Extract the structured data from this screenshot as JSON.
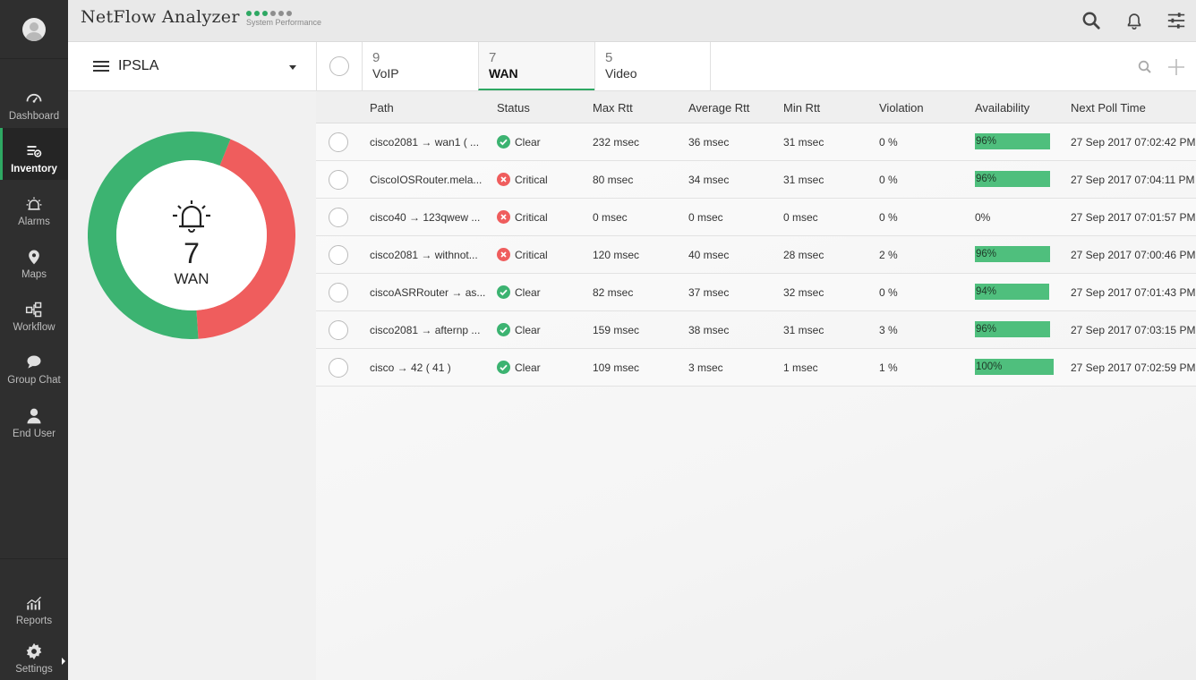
{
  "app": {
    "title": "NetFlow Analyzer",
    "perf_label": "System Performance"
  },
  "sidebar": {
    "items": [
      {
        "label": "Dashboard",
        "icon": "gauge-icon"
      },
      {
        "label": "Inventory",
        "icon": "inventory-icon",
        "active": true
      },
      {
        "label": "Alarms",
        "icon": "alarm-icon"
      },
      {
        "label": "Maps",
        "icon": "map-pin-icon"
      },
      {
        "label": "Workflow",
        "icon": "workflow-icon"
      },
      {
        "label": "Group Chat",
        "icon": "chat-icon"
      },
      {
        "label": "End User",
        "icon": "user-icon"
      }
    ],
    "bottom_items": [
      {
        "label": "Reports",
        "icon": "reports-icon"
      },
      {
        "label": "Settings",
        "icon": "gear-icon"
      }
    ]
  },
  "group_select": {
    "label": "IPSLA"
  },
  "tabs": [
    {
      "count": "9",
      "name": "VoIP"
    },
    {
      "count": "7",
      "name": "WAN",
      "active": true
    },
    {
      "count": "5",
      "name": "Video"
    }
  ],
  "summary": {
    "count": "7",
    "label": "WAN",
    "clear": 4,
    "critical": 3,
    "colors": {
      "clear": "#3cb371",
      "critical": "#ef5d5d"
    }
  },
  "table": {
    "headers": [
      "Path",
      "Status",
      "Max Rtt",
      "Average Rtt",
      "Min Rtt",
      "Violation",
      "Availability",
      "Next Poll Time"
    ],
    "rows": [
      {
        "path": "cisco2081 → wan1 ( ...",
        "status": "Clear",
        "max_rtt": "232 msec",
        "avg_rtt": "36 msec",
        "min_rtt": "31 msec",
        "violation": "0 %",
        "availability": "96%",
        "availability_value": 0.96,
        "next_poll": "27 Sep 2017 07:02:42 PM"
      },
      {
        "path": "CiscoIOSRouter.mela...",
        "status": "Critical",
        "max_rtt": "80 msec",
        "avg_rtt": "34 msec",
        "min_rtt": "31 msec",
        "violation": "0 %",
        "availability": "96%",
        "availability_value": 0.96,
        "next_poll": "27 Sep 2017 07:04:11 PM"
      },
      {
        "path": "cisco40 → 123qwew ...",
        "status": "Critical",
        "max_rtt": "0 msec",
        "avg_rtt": "0 msec",
        "min_rtt": "0 msec",
        "violation": "0 %",
        "availability": "0%",
        "availability_value": 0,
        "next_poll": "27 Sep 2017 07:01:57 PM"
      },
      {
        "path": "cisco2081 → withnot...",
        "status": "Critical",
        "max_rtt": "120 msec",
        "avg_rtt": "40 msec",
        "min_rtt": "28 msec",
        "violation": "2 %",
        "availability": "96%",
        "availability_value": 0.96,
        "next_poll": "27 Sep 2017 07:00:46 PM"
      },
      {
        "path": "ciscoASRRouter → as...",
        "status": "Clear",
        "max_rtt": "82 msec",
        "avg_rtt": "37 msec",
        "min_rtt": "32 msec",
        "violation": "0 %",
        "availability": "94%",
        "availability_value": 0.94,
        "next_poll": "27 Sep 2017 07:01:43 PM"
      },
      {
        "path": "cisco2081 → afternp ...",
        "status": "Clear",
        "max_rtt": "159 msec",
        "avg_rtt": "38 msec",
        "min_rtt": "31 msec",
        "violation": "3 %",
        "availability": "96%",
        "availability_value": 0.96,
        "next_poll": "27 Sep 2017 07:03:15 PM"
      },
      {
        "path": "cisco → 42 ( 41 )",
        "status": "Clear",
        "max_rtt": "109 msec",
        "avg_rtt": "3 msec",
        "min_rtt": "1 msec",
        "violation": "1 %",
        "availability": "100%",
        "availability_value": 1.0,
        "next_poll": "27 Sep 2017 07:02:59 PM"
      }
    ]
  }
}
